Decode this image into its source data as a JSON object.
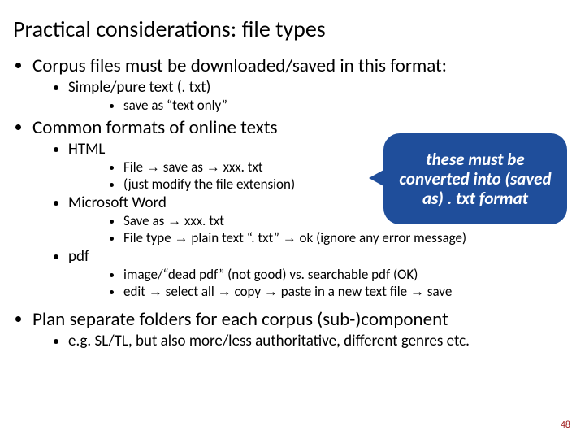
{
  "title": "Practical considerations: file types",
  "arrow": "→",
  "b1": "Corpus files must be downloaded/saved in this format:",
  "b1a": "Simple/pure text (. txt)",
  "b1a1": "save as “text only”",
  "b2": "Common formats of online texts",
  "b2a": "HTML",
  "b2a1_pre": "File ",
  "b2a1_mid": " save as ",
  "b2a1_post": " xxx. txt",
  "b2a2": "(just modify the file extension)",
  "b2b": "Microsoft Word",
  "b2b1_pre": "Save as ",
  "b2b1_post": " xxx. txt",
  "b2b2_pre": "File type ",
  "b2b2_mid": " plain text “. txt” ",
  "b2b2_post": " ok (ignore any error message)",
  "b2c": "pdf",
  "b2c1": "image/“dead pdf” (not good) vs. searchable pdf (OK)",
  "b2c2_1": "edit ",
  "b2c2_2": " select all ",
  "b2c2_3": " copy ",
  "b2c2_4": " paste in a new text file ",
  "b2c2_5": " save",
  "b3": "Plan separate folders for each corpus (sub-)component",
  "b3a": "e.g. SL/TL, but also more/less authoritative, different genres etc.",
  "callout": "these must be converted into (saved as) . txt format",
  "page": "48"
}
